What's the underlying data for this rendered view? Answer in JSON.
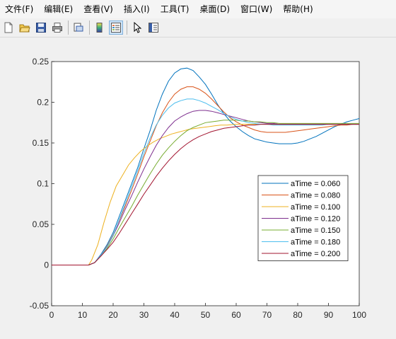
{
  "menu": [
    "文件(F)",
    "编辑(E)",
    "查看(V)",
    "插入(I)",
    "工具(T)",
    "桌面(D)",
    "窗口(W)",
    "帮助(H)"
  ],
  "toolbar": {
    "icons": [
      "new-file-icon",
      "open-folder-icon",
      "save-icon",
      "print-icon",
      "print-preview-icon",
      "colorbar-icon",
      "legend-icon",
      "pointer-icon",
      "property-editor-icon"
    ],
    "active": "legend-icon"
  },
  "chart_data": {
    "type": "line",
    "xlim": [
      0,
      100
    ],
    "ylim": [
      -0.05,
      0.25
    ],
    "xticks": [
      "0",
      "10",
      "20",
      "30",
      "40",
      "50",
      "60",
      "70",
      "80",
      "90",
      "100"
    ],
    "yticks": [
      "-0.05",
      "0",
      "0.05",
      "0.1",
      "0.15",
      "0.2",
      "0.25"
    ],
    "legend_position": "lower-right",
    "series": [
      {
        "name": "aTime = 0.060",
        "color": "#0072BD",
        "x": [
          0,
          12,
          14,
          16,
          18,
          20,
          22,
          24,
          26,
          28,
          30,
          32,
          34,
          36,
          38,
          40,
          42,
          44,
          46,
          48,
          50,
          52,
          54,
          56,
          58,
          60,
          62,
          64,
          66,
          68,
          70,
          72,
          74,
          76,
          78,
          80,
          82,
          84,
          86,
          88,
          90,
          92,
          94,
          96,
          98,
          100
        ],
        "y": [
          0,
          0,
          0.003,
          0.013,
          0.025,
          0.04,
          0.06,
          0.08,
          0.1,
          0.12,
          0.143,
          0.165,
          0.19,
          0.21,
          0.226,
          0.236,
          0.241,
          0.242,
          0.239,
          0.231,
          0.222,
          0.21,
          0.197,
          0.186,
          0.177,
          0.17,
          0.164,
          0.159,
          0.155,
          0.153,
          0.151,
          0.15,
          0.149,
          0.149,
          0.149,
          0.15,
          0.152,
          0.155,
          0.158,
          0.162,
          0.166,
          0.17,
          0.173,
          0.176,
          0.178,
          0.18
        ]
      },
      {
        "name": "aTime = 0.080",
        "color": "#D95319",
        "x": [
          0,
          12,
          14,
          16,
          18,
          20,
          22,
          24,
          26,
          28,
          30,
          32,
          34,
          36,
          38,
          40,
          42,
          44,
          46,
          48,
          50,
          52,
          54,
          56,
          58,
          60,
          62,
          64,
          66,
          68,
          70,
          72,
          74,
          76,
          78,
          80,
          82,
          84,
          86,
          88,
          90,
          92,
          94,
          96,
          98,
          100
        ],
        "y": [
          0,
          0,
          0.003,
          0.012,
          0.023,
          0.037,
          0.055,
          0.073,
          0.092,
          0.112,
          0.133,
          0.152,
          0.171,
          0.187,
          0.2,
          0.21,
          0.216,
          0.219,
          0.219,
          0.216,
          0.211,
          0.204,
          0.196,
          0.188,
          0.181,
          0.176,
          0.172,
          0.169,
          0.166,
          0.164,
          0.163,
          0.163,
          0.163,
          0.163,
          0.164,
          0.165,
          0.166,
          0.167,
          0.168,
          0.169,
          0.17,
          0.171,
          0.172,
          0.172,
          0.173,
          0.173
        ]
      },
      {
        "name": "aTime = 0.100",
        "color": "#EDB120",
        "x": [
          0,
          12,
          13,
          15,
          17,
          19,
          21,
          23,
          25,
          27,
          29,
          31,
          33,
          35,
          37,
          39,
          41,
          43,
          45,
          47,
          49,
          51,
          53,
          55,
          57,
          60,
          65,
          70,
          75,
          80,
          85,
          90,
          95,
          100
        ],
        "y": [
          0,
          0,
          0.006,
          0.025,
          0.052,
          0.077,
          0.097,
          0.11,
          0.123,
          0.132,
          0.14,
          0.146,
          0.151,
          0.155,
          0.158,
          0.161,
          0.163,
          0.165,
          0.167,
          0.168,
          0.169,
          0.17,
          0.171,
          0.172,
          0.172,
          0.173,
          0.173,
          0.173,
          0.173,
          0.173,
          0.173,
          0.173,
          0.173,
          0.173
        ]
      },
      {
        "name": "aTime = 0.120",
        "color": "#7E2F8E",
        "x": [
          0,
          12,
          14,
          16,
          18,
          20,
          22,
          24,
          26,
          28,
          30,
          32,
          34,
          36,
          38,
          40,
          42,
          44,
          46,
          48,
          50,
          52,
          54,
          56,
          58,
          60,
          62,
          64,
          66,
          68,
          70,
          72,
          74,
          76,
          78,
          80,
          82,
          84,
          86,
          88,
          90,
          92,
          94,
          96,
          98,
          100
        ],
        "y": [
          0,
          0,
          0.003,
          0.012,
          0.022,
          0.036,
          0.052,
          0.069,
          0.085,
          0.102,
          0.118,
          0.133,
          0.147,
          0.159,
          0.169,
          0.177,
          0.182,
          0.186,
          0.189,
          0.19,
          0.19,
          0.189,
          0.187,
          0.185,
          0.183,
          0.181,
          0.179,
          0.177,
          0.176,
          0.175,
          0.174,
          0.174,
          0.173,
          0.173,
          0.173,
          0.173,
          0.173,
          0.173,
          0.173,
          0.173,
          0.173,
          0.173,
          0.173,
          0.173,
          0.173,
          0.173
        ]
      },
      {
        "name": "aTime = 0.150",
        "color": "#77AC30",
        "x": [
          0,
          12,
          14,
          16,
          18,
          20,
          22,
          24,
          26,
          28,
          30,
          32,
          34,
          36,
          38,
          40,
          42,
          44,
          46,
          48,
          50,
          52,
          54,
          56,
          58,
          60,
          62,
          64,
          66,
          68,
          70,
          72,
          74,
          76,
          78,
          80,
          85,
          90,
          95,
          100
        ],
        "y": [
          0,
          0,
          0.003,
          0.011,
          0.02,
          0.032,
          0.046,
          0.059,
          0.072,
          0.086,
          0.099,
          0.112,
          0.124,
          0.135,
          0.144,
          0.152,
          0.159,
          0.165,
          0.169,
          0.172,
          0.175,
          0.176,
          0.177,
          0.178,
          0.178,
          0.178,
          0.177,
          0.177,
          0.176,
          0.176,
          0.175,
          0.175,
          0.174,
          0.174,
          0.174,
          0.174,
          0.174,
          0.174,
          0.174,
          0.174
        ]
      },
      {
        "name": "aTime = 0.180",
        "color": "#4DBEEE",
        "x": [
          0,
          12,
          14,
          16,
          18,
          20,
          22,
          24,
          26,
          28,
          30,
          32,
          34,
          36,
          38,
          40,
          42,
          44,
          46,
          48,
          50,
          52,
          54,
          56,
          58,
          60,
          62,
          64,
          66,
          68,
          70,
          72,
          74,
          76,
          78,
          80,
          82,
          84,
          86,
          88,
          90,
          92,
          94,
          96,
          98,
          100
        ],
        "y": [
          0,
          0,
          0.003,
          0.012,
          0.022,
          0.036,
          0.056,
          0.076,
          0.096,
          0.116,
          0.137,
          0.156,
          0.172,
          0.184,
          0.193,
          0.199,
          0.202,
          0.204,
          0.204,
          0.202,
          0.199,
          0.195,
          0.191,
          0.186,
          0.182,
          0.179,
          0.177,
          0.175,
          0.174,
          0.173,
          0.173,
          0.172,
          0.172,
          0.172,
          0.172,
          0.172,
          0.172,
          0.172,
          0.172,
          0.172,
          0.173,
          0.173,
          0.173,
          0.173,
          0.173,
          0.173
        ]
      },
      {
        "name": "aTime = 0.200",
        "color": "#A2142F",
        "x": [
          0,
          12,
          14,
          16,
          18,
          20,
          22,
          24,
          26,
          28,
          30,
          32,
          34,
          36,
          38,
          40,
          42,
          44,
          46,
          48,
          50,
          52,
          54,
          56,
          58,
          60,
          62,
          64,
          66,
          68,
          70,
          72,
          74,
          76,
          78,
          80,
          85,
          90,
          95,
          100
        ],
        "y": [
          0,
          0,
          0.003,
          0.011,
          0.019,
          0.028,
          0.039,
          0.051,
          0.063,
          0.075,
          0.087,
          0.098,
          0.109,
          0.119,
          0.128,
          0.136,
          0.143,
          0.149,
          0.154,
          0.158,
          0.161,
          0.164,
          0.166,
          0.168,
          0.169,
          0.17,
          0.171,
          0.172,
          0.172,
          0.173,
          0.173,
          0.173,
          0.173,
          0.173,
          0.173,
          0.173,
          0.173,
          0.173,
          0.173,
          0.173
        ]
      }
    ]
  }
}
